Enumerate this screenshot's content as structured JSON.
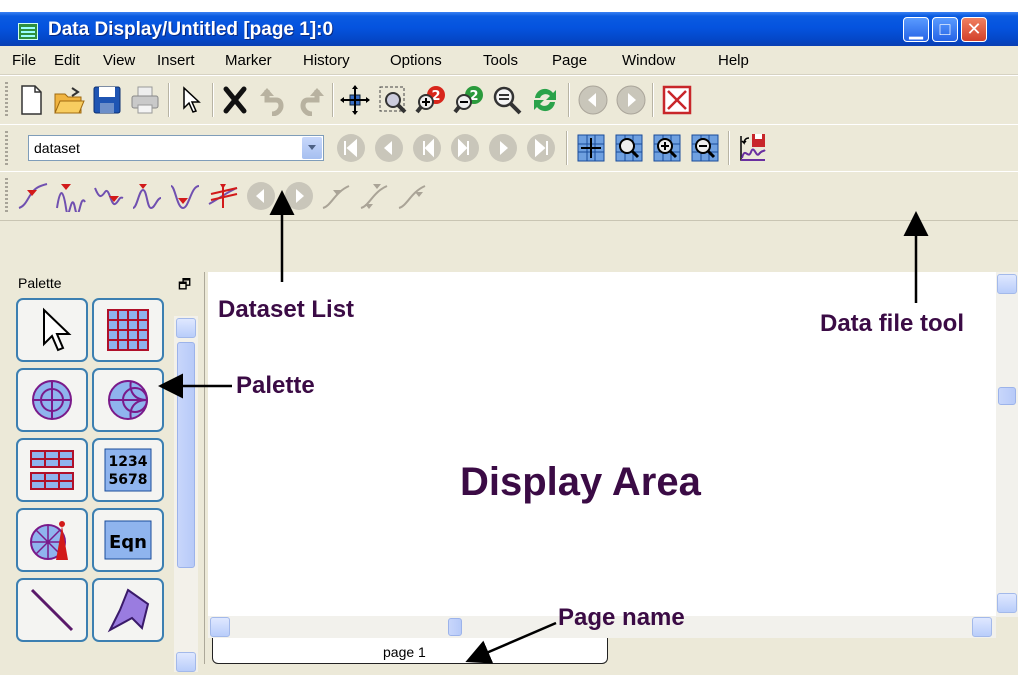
{
  "window": {
    "title": "Data Display/Untitled [page 1]:0",
    "minimize_glyph": "▁",
    "maximize_glyph": "□",
    "close_glyph": "✕"
  },
  "menu": [
    "File",
    "Edit",
    "View",
    "Insert",
    "Marker",
    "History",
    "Options",
    "Tools",
    "Page",
    "Window",
    "Help"
  ],
  "toolbar": {
    "dataset_value": "dataset"
  },
  "palette": {
    "title": "Palette",
    "items": [
      "arrow-select",
      "rectangular-plot",
      "polar-plot",
      "smith-chart",
      "stacked-rectangular-plot",
      "list",
      "antenna-plot",
      "equation",
      "polyline",
      "polygon"
    ],
    "list_label_top": "1234",
    "list_label_bottom": "5678",
    "equation_label": "Eqn"
  },
  "display": {
    "title": "Display Area"
  },
  "page_tab": {
    "label": "page 1"
  },
  "annotations": {
    "dataset_list": "Dataset List",
    "data_file_tool": "Data file tool",
    "palette": "Palette",
    "page_name": "Page name"
  },
  "colors": {
    "titlebar": "#0553df",
    "annotation": "#3b0b45",
    "palette_border": "#3c7fb1",
    "window_bg": "#ece9d8"
  }
}
